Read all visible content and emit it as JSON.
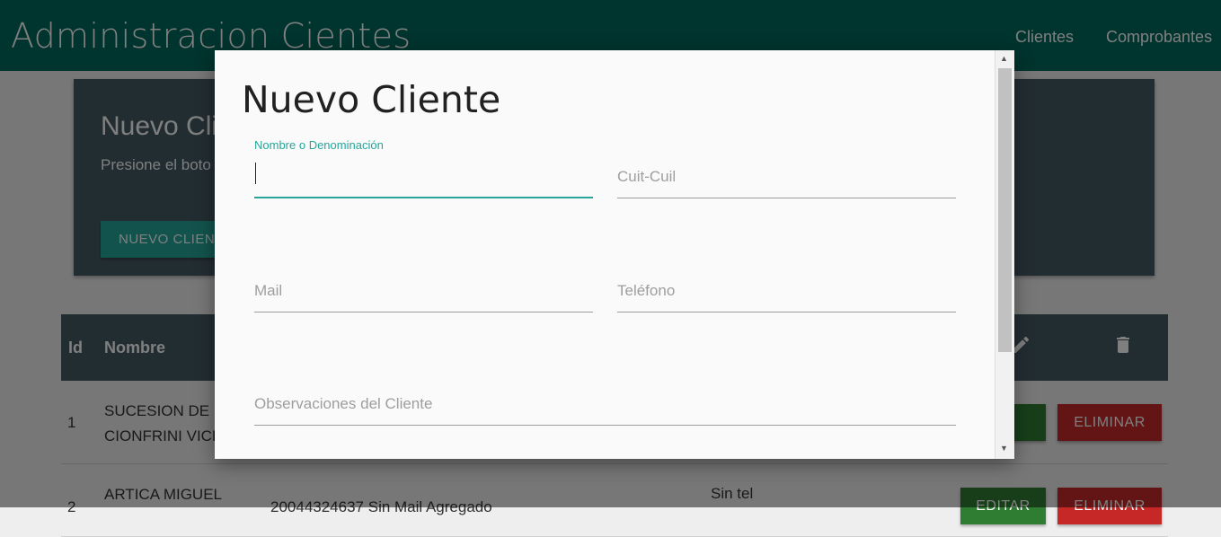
{
  "header": {
    "brand": "Administracion Cientes",
    "nav": [
      "Clientes",
      "Comprobantes"
    ]
  },
  "hero": {
    "title": "Nuevo Cli",
    "text": "Presione el boto",
    "button": "NUEVO CLIEN"
  },
  "table": {
    "headers": {
      "id": "Id",
      "nombre": "Nombre"
    },
    "rows": [
      {
        "id": "1",
        "nombre_line1": "SUCESION DE",
        "nombre_line2": "CIONFRINI VICE",
        "edit": "AR",
        "delete": "ELIMINAR"
      },
      {
        "id": "2",
        "nombre_line1": "ARTICA MIGUEL",
        "cuit_mail": "20044324637  Sin Mail Agregado",
        "tel": "Sin tel",
        "edit": "EDITAR",
        "delete": "ELIMINAR"
      }
    ]
  },
  "modal": {
    "title": "Nuevo Cliente",
    "fields": {
      "nombre_label": "Nombre o Denominación",
      "cuit_placeholder": "Cuit-Cuil",
      "mail_placeholder": "Mail",
      "telefono_placeholder": "Teléfono",
      "observaciones_placeholder": "Observaciones del Cliente"
    }
  },
  "colors": {
    "primary": "#00695c",
    "accent": "#26a69a",
    "card": "#455a64",
    "edit": "#2e7d32",
    "delete": "#c62828"
  },
  "icons": [
    "pencil-icon",
    "trash-icon",
    "scroll-up-arrow-icon",
    "scroll-down-arrow-icon"
  ]
}
